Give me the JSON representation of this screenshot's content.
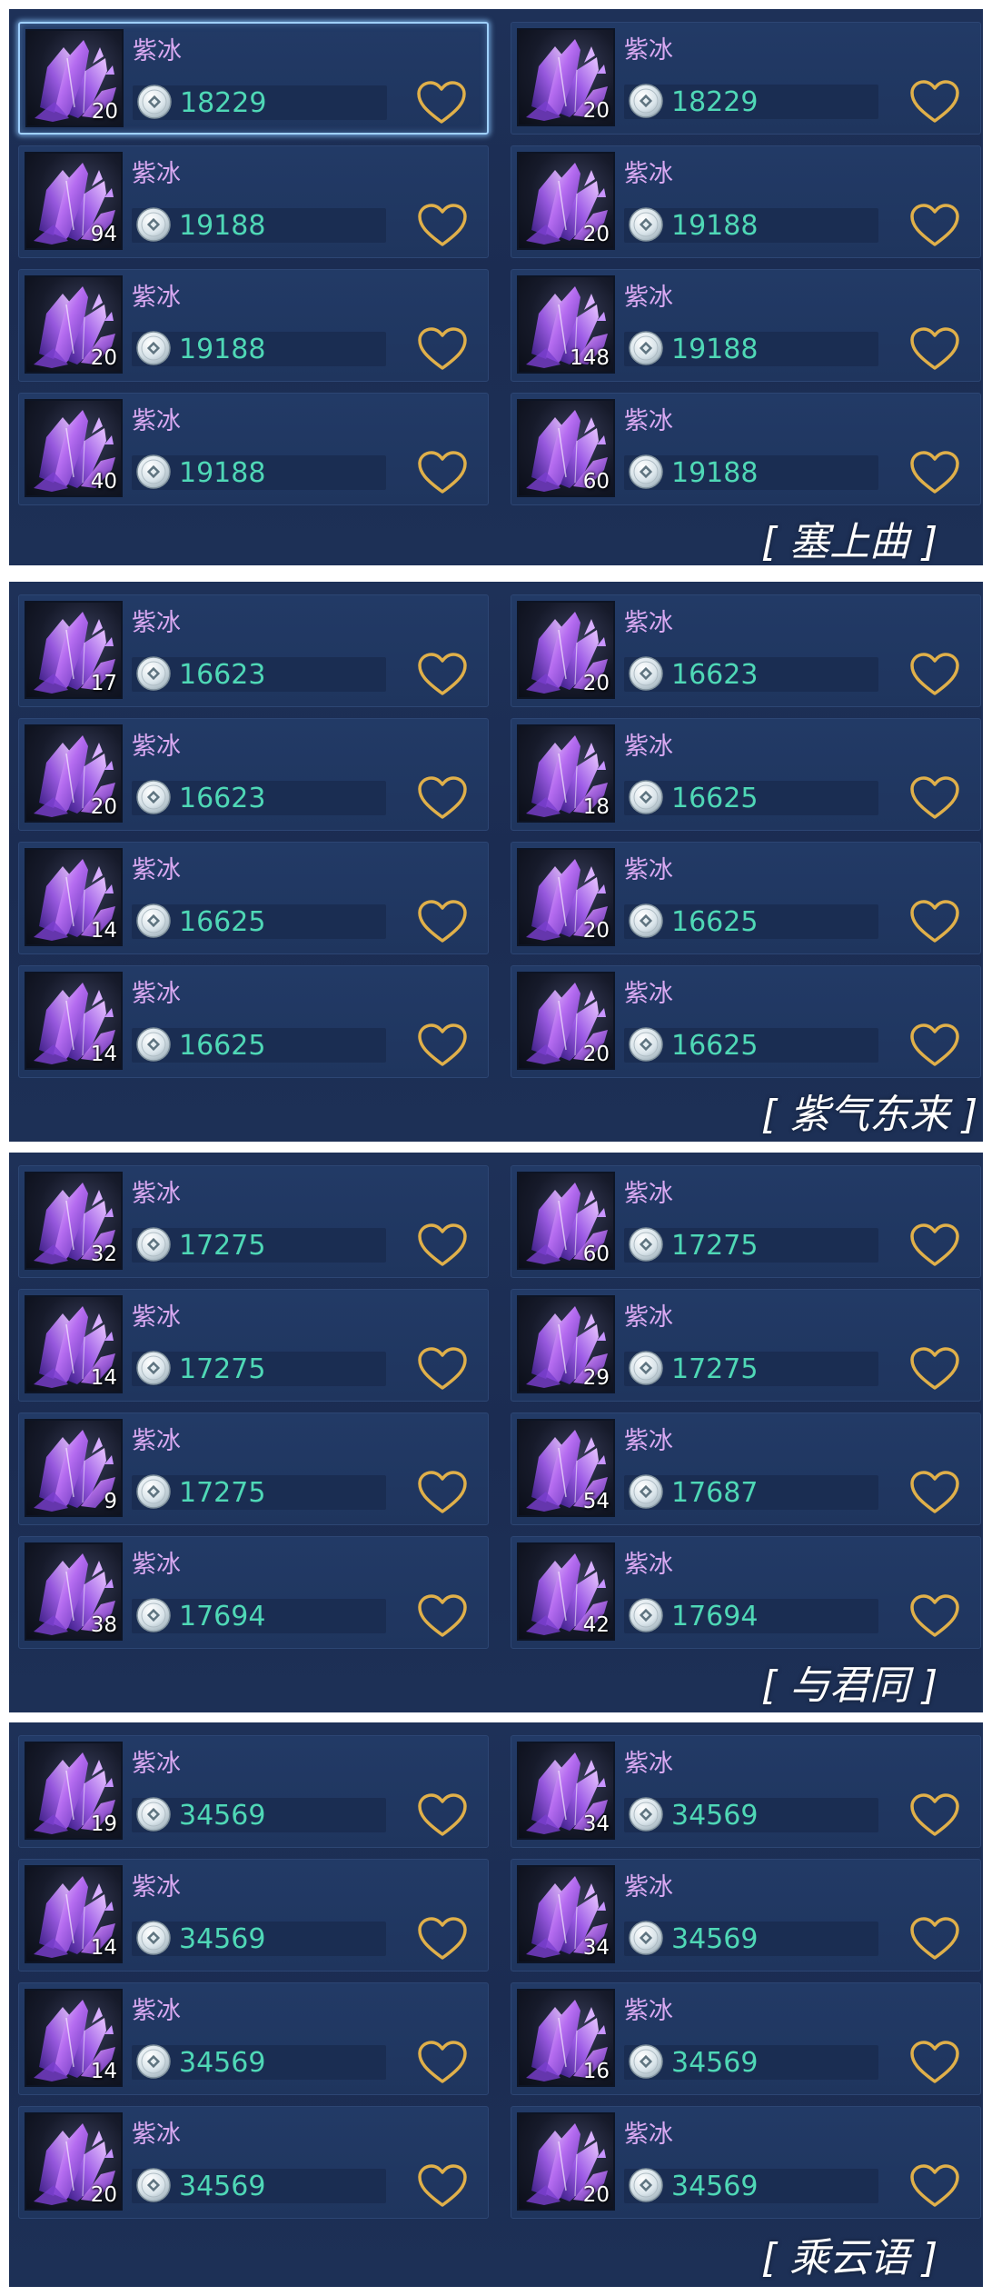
{
  "item_name": "紫冰",
  "item_icon": "purple-ice-crystal-icon",
  "currency_icon": "silver-coin-icon",
  "favorite_icon": "heart-outline-icon",
  "colors": {
    "panel_bg": "#1e3158",
    "card_bg": "#223a66",
    "name": "#d9a9f2",
    "price": "#4fd8b6",
    "heart": "#e0b04a",
    "selected_border": "#9fd0ff"
  },
  "panels": [
    {
      "title": "[ 塞上曲 ]",
      "listings": [
        {
          "qty": "20",
          "price": "18229",
          "selected": true
        },
        {
          "qty": "20",
          "price": "18229"
        },
        {
          "qty": "94",
          "price": "19188"
        },
        {
          "qty": "20",
          "price": "19188"
        },
        {
          "qty": "20",
          "price": "19188"
        },
        {
          "qty": "148",
          "price": "19188"
        },
        {
          "qty": "40",
          "price": "19188"
        },
        {
          "qty": "60",
          "price": "19188"
        }
      ]
    },
    {
      "title": "[ 紫气东来 ]",
      "listings": [
        {
          "qty": "17",
          "price": "16623"
        },
        {
          "qty": "20",
          "price": "16623"
        },
        {
          "qty": "20",
          "price": "16623"
        },
        {
          "qty": "18",
          "price": "16625"
        },
        {
          "qty": "14",
          "price": "16625"
        },
        {
          "qty": "20",
          "price": "16625"
        },
        {
          "qty": "14",
          "price": "16625"
        },
        {
          "qty": "20",
          "price": "16625"
        }
      ]
    },
    {
      "title": "[ 与君同 ]",
      "listings": [
        {
          "qty": "32",
          "price": "17275"
        },
        {
          "qty": "60",
          "price": "17275"
        },
        {
          "qty": "14",
          "price": "17275"
        },
        {
          "qty": "29",
          "price": "17275"
        },
        {
          "qty": "9",
          "price": "17275"
        },
        {
          "qty": "54",
          "price": "17687"
        },
        {
          "qty": "38",
          "price": "17694"
        },
        {
          "qty": "42",
          "price": "17694"
        }
      ]
    },
    {
      "title": "[ 乘云语 ]",
      "listings": [
        {
          "qty": "19",
          "price": "34569"
        },
        {
          "qty": "34",
          "price": "34569"
        },
        {
          "qty": "14",
          "price": "34569"
        },
        {
          "qty": "34",
          "price": "34569"
        },
        {
          "qty": "14",
          "price": "34569"
        },
        {
          "qty": "16",
          "price": "34569"
        },
        {
          "qty": "20",
          "price": "34569"
        },
        {
          "qty": "20",
          "price": "34569"
        }
      ]
    }
  ]
}
